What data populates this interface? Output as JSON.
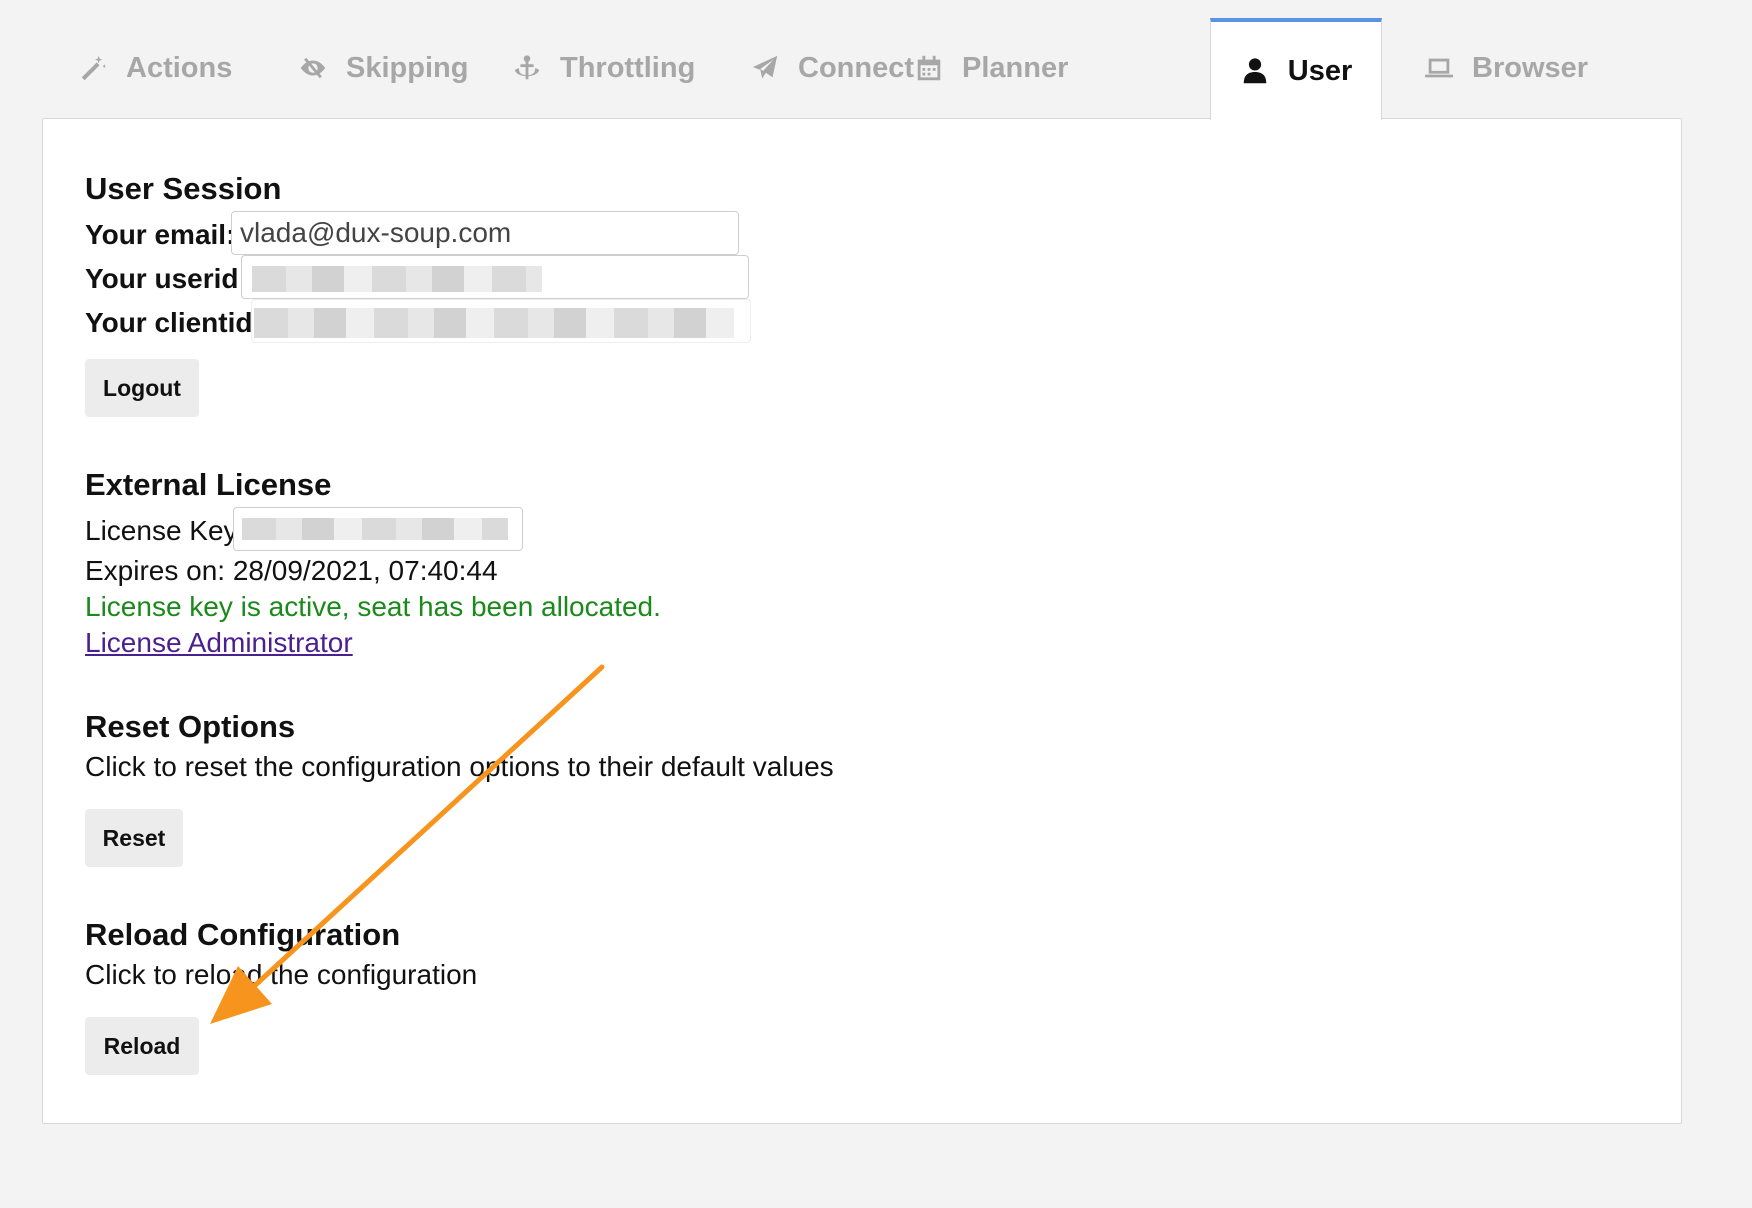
{
  "tabs": [
    {
      "label": "Actions",
      "icon": "magic-wand-icon"
    },
    {
      "label": "Skipping",
      "icon": "eye-slash-icon"
    },
    {
      "label": "Throttling",
      "icon": "anchor-icon"
    },
    {
      "label": "Connect",
      "icon": "paper-plane-icon"
    },
    {
      "label": "Planner",
      "icon": "calendar-icon"
    },
    {
      "label": "User",
      "icon": "user-icon",
      "active": true
    },
    {
      "label": "Browser",
      "icon": "laptop-icon"
    }
  ],
  "session": {
    "heading": "User Session",
    "email_label": "Your email:",
    "email_value": "vlada@dux-soup.com",
    "userid_label": "Your userid:",
    "clientid_label": "Your clientid:",
    "logout_label": "Logout"
  },
  "license": {
    "heading": "External License",
    "key_label": "License Key:",
    "expires": "Expires on: 28/09/2021, 07:40:44",
    "status": "License key is active, seat has been allocated.",
    "admin_link": "License Administrator"
  },
  "reset": {
    "heading": "Reset Options",
    "description": "Click to reset the configuration options to their default values",
    "button": "Reset"
  },
  "reload": {
    "heading": "Reload Configuration",
    "description": "Click to reload the configuration",
    "button": "Reload"
  },
  "colors": {
    "active_tab_border": "#5b92e5",
    "status_green": "#1b8a1b",
    "link_purple": "#4b1f8f",
    "arrow_orange": "#f7941d"
  }
}
